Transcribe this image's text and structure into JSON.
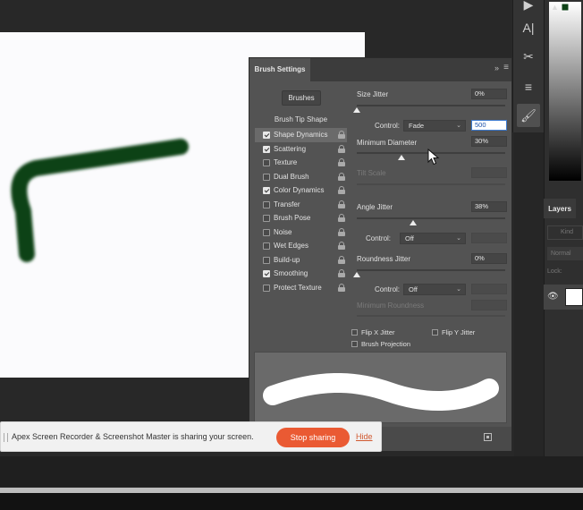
{
  "brush_panel": {
    "title": "Brush Settings",
    "collapse_icon": "double-chevron-right-icon",
    "menu_icon": "hamburger-menu-icon",
    "brushes_button": "Brushes",
    "tip_shape": "Brush Tip Shape",
    "options": [
      {
        "label": "Shape Dynamics",
        "checked": true,
        "selected": true
      },
      {
        "label": "Scattering",
        "checked": true,
        "selected": false
      },
      {
        "label": "Texture",
        "checked": false,
        "selected": false
      },
      {
        "label": "Dual Brush",
        "checked": false,
        "selected": false
      },
      {
        "label": "Color Dynamics",
        "checked": true,
        "selected": false
      },
      {
        "label": "Transfer",
        "checked": false,
        "selected": false
      },
      {
        "label": "Brush Pose",
        "checked": false,
        "selected": false
      },
      {
        "label": "Noise",
        "checked": false,
        "selected": false
      },
      {
        "label": "Wet Edges",
        "checked": false,
        "selected": false
      },
      {
        "label": "Build-up",
        "checked": false,
        "selected": false
      },
      {
        "label": "Smoothing",
        "checked": true,
        "selected": false
      },
      {
        "label": "Protect Texture",
        "checked": false,
        "selected": false
      }
    ],
    "size_jitter": {
      "label": "Size Jitter",
      "value": "0%",
      "level": 0
    },
    "size_control": {
      "label": "Control:",
      "value": "Fade",
      "steps": "500"
    },
    "min_diameter": {
      "label": "Minimum Diameter",
      "value": "30%",
      "level": 30
    },
    "tilt_scale": {
      "label": "Tilt Scale"
    },
    "angle_jitter": {
      "label": "Angle Jitter",
      "value": "38%",
      "level": 38
    },
    "angle_control": {
      "label": "Control:",
      "value": "Off"
    },
    "roundness_jitter": {
      "label": "Roundness Jitter",
      "value": "0%",
      "level": 0
    },
    "roundness_control": {
      "label": "Control:",
      "value": "Off"
    },
    "min_roundness": {
      "label": "Minimum Roundness"
    },
    "flip_x": "Flip X Jitter",
    "flip_y": "Flip Y Jitter",
    "projection": "Brush Projection"
  },
  "canvas": {
    "stroke_color": "#0e4217"
  },
  "layers": {
    "tab": "Layers",
    "search_placeholder": "Kind",
    "blend_mode": "Normal",
    "lock_label": "Lock:"
  },
  "sharing": {
    "message": "Apex Screen Recorder & Screenshot Master is sharing your screen.",
    "stop_button": "Stop sharing",
    "hide_link": "Hide",
    "accent": "#ea5a33"
  },
  "colors": {
    "panel_bg": "#535353",
    "canvas_bg": "#fbfbfd"
  }
}
